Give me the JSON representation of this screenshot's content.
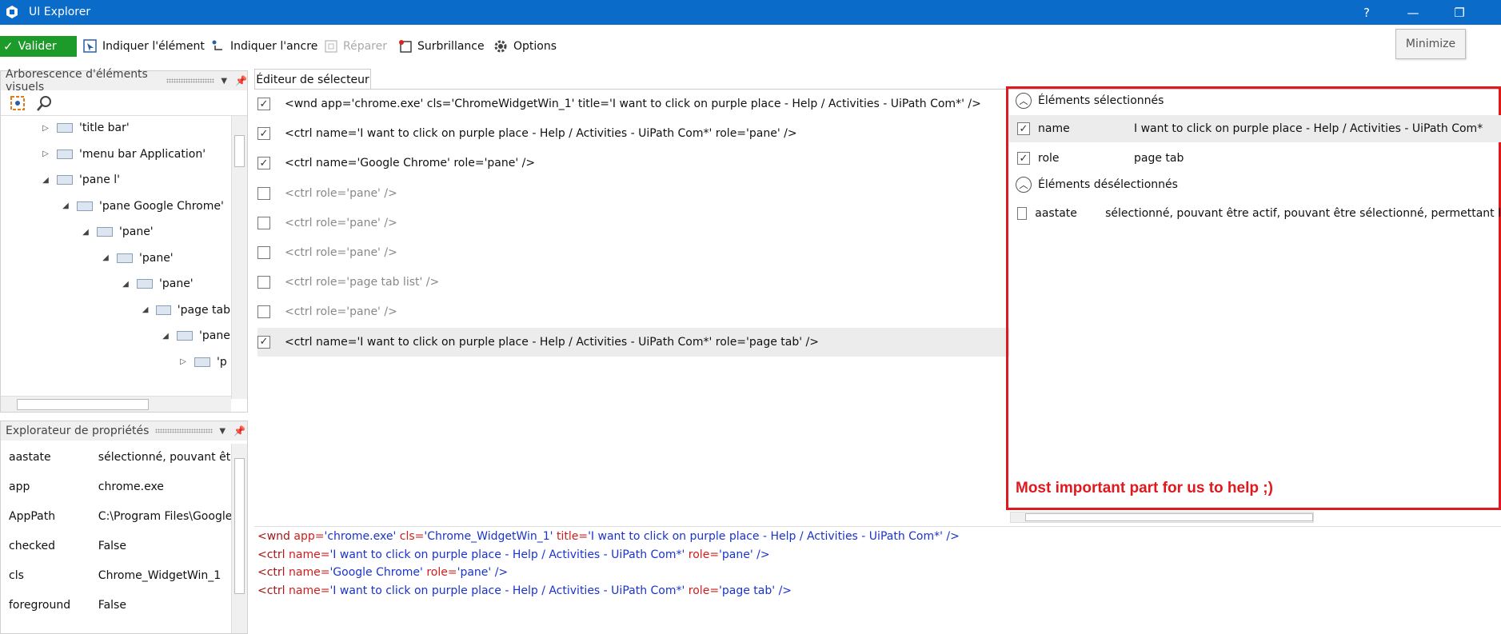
{
  "window": {
    "title": "UI Explorer",
    "help": "?",
    "minimize_glyph": "—",
    "restore_glyph": "❐",
    "tooltip": "Minimize"
  },
  "toolbar": {
    "validate": "Valider",
    "indicate_element": "Indiquer l'élément",
    "indicate_anchor": "Indiquer l'ancre",
    "repair": "Réparer",
    "highlight": "Surbrillance",
    "options": "Options"
  },
  "tree_panel": {
    "title": "Arborescence d'éléments visuels",
    "nodes": [
      {
        "label": "'title bar'",
        "expander": "▷"
      },
      {
        "label": "'menu bar  Application'",
        "expander": "▷"
      },
      {
        "label": "'pane l'",
        "expander": "◢"
      },
      {
        "label": "'pane  Google Chrome'",
        "expander": "◢"
      },
      {
        "label": "'pane'",
        "expander": "◢"
      },
      {
        "label": "'pane'",
        "expander": "◢"
      },
      {
        "label": "'pane'",
        "expander": "◢"
      },
      {
        "label": "'page tab",
        "expander": "◢"
      },
      {
        "label": "'pane",
        "expander": "◢"
      },
      {
        "label": "'p",
        "expander": "▷"
      }
    ]
  },
  "props_panel": {
    "title": "Explorateur de propriétés",
    "rows": [
      {
        "key": "aastate",
        "value": "sélectionné, pouvant être"
      },
      {
        "key": "app",
        "value": "chrome.exe"
      },
      {
        "key": "AppPath",
        "value": "C:\\Program Files\\Google\\"
      },
      {
        "key": "checked",
        "value": "False"
      },
      {
        "key": "cls",
        "value": "Chrome_WidgetWin_1"
      },
      {
        "key": "foreground",
        "value": "False"
      }
    ]
  },
  "selector_editor": {
    "tab": "Éditeur de sélecteur",
    "rows": [
      {
        "checked": true,
        "text": "<wnd app='chrome.exe' cls='ChromeWidgetWin_1' title='I want to click on purple place - Help / Activities - UiPath Com*' />"
      },
      {
        "checked": true,
        "text": "<ctrl name='I want to click on purple place - Help / Activities - UiPath Com*' role='pane' />"
      },
      {
        "checked": true,
        "text": "<ctrl name='Google Chrome' role='pane' />"
      },
      {
        "checked": false,
        "text": "<ctrl role='pane' />"
      },
      {
        "checked": false,
        "text": "<ctrl role='pane' />"
      },
      {
        "checked": false,
        "text": "<ctrl role='pane' />"
      },
      {
        "checked": false,
        "text": "<ctrl role='page tab list' />"
      },
      {
        "checked": false,
        "text": "<ctrl role='pane' />"
      },
      {
        "checked": true,
        "text": "<ctrl name='I want to click on purple place - Help / Activities - UiPath Com*' role='page tab' />"
      }
    ]
  },
  "attributes": {
    "selected_header": "Éléments sélectionnés",
    "selected": [
      {
        "key": "name",
        "value": "I want to click on purple place - Help / Activities - UiPath Com*",
        "checked": true
      },
      {
        "key": "role",
        "value": "page tab",
        "checked": true
      }
    ],
    "deselected_header": "Éléments désélectionnés",
    "deselected": [
      {
        "key": "aastate",
        "value": "sélectionné, pouvant être actif, pouvant être sélectionné, permettant l",
        "checked": false
      }
    ],
    "annotation": "Most important part for us to help ;)"
  },
  "preview": {
    "lines": [
      [
        {
          "t": "<wnd ",
          "c": "tag"
        },
        {
          "t": "app=",
          "c": "an"
        },
        {
          "t": "'chrome.exe' ",
          "c": "av"
        },
        {
          "t": "cls=",
          "c": "an"
        },
        {
          "t": "'Chrome_WidgetWin_1' ",
          "c": "av"
        },
        {
          "t": "title=",
          "c": "an"
        },
        {
          "t": "'I want to click on purple place - Help / Activities - UiPath Com*' />",
          "c": "av"
        }
      ],
      [
        {
          "t": "<ctrl ",
          "c": "tag"
        },
        {
          "t": "name=",
          "c": "an"
        },
        {
          "t": "'I want to click on purple place - Help / Activities - UiPath Com*' ",
          "c": "av"
        },
        {
          "t": "role=",
          "c": "an"
        },
        {
          "t": "'pane' />",
          "c": "av"
        }
      ],
      [
        {
          "t": "<ctrl ",
          "c": "tag"
        },
        {
          "t": "name=",
          "c": "an"
        },
        {
          "t": "'Google Chrome' ",
          "c": "av"
        },
        {
          "t": "role=",
          "c": "an"
        },
        {
          "t": "'pane' />",
          "c": "av"
        }
      ],
      [
        {
          "t": "<ctrl ",
          "c": "tag"
        },
        {
          "t": "name=",
          "c": "an"
        },
        {
          "t": "'I want to click on purple place - Help / Activities - UiPath Com*' ",
          "c": "av"
        },
        {
          "t": "role=",
          "c": "an"
        },
        {
          "t": "'page tab' />",
          "c": "av"
        }
      ]
    ]
  },
  "colors": {
    "titlebar": "#0b6bc8",
    "validate": "#1d9b2a",
    "annotation_red": "#e0191e"
  }
}
